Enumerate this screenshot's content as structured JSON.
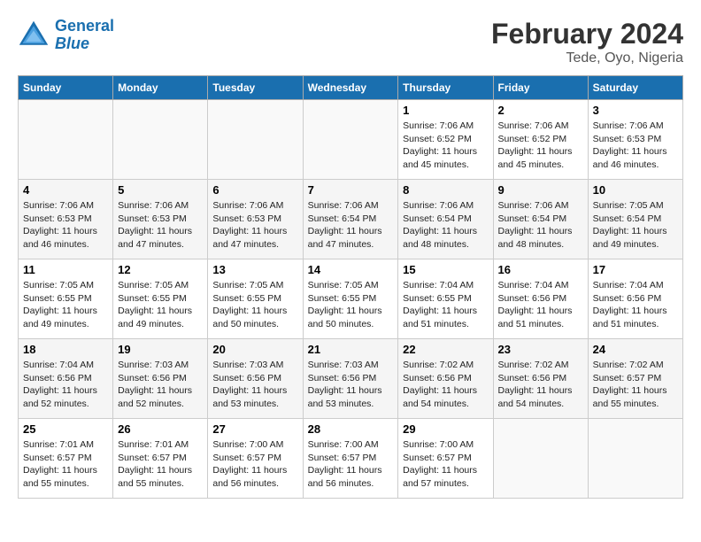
{
  "header": {
    "logo_line1": "General",
    "logo_line2": "Blue",
    "month_title": "February 2024",
    "subtitle": "Tede, Oyo, Nigeria"
  },
  "columns": [
    "Sunday",
    "Monday",
    "Tuesday",
    "Wednesday",
    "Thursday",
    "Friday",
    "Saturday"
  ],
  "rows": [
    [
      {
        "day": "",
        "info": ""
      },
      {
        "day": "",
        "info": ""
      },
      {
        "day": "",
        "info": ""
      },
      {
        "day": "",
        "info": ""
      },
      {
        "day": "1",
        "info": "Sunrise: 7:06 AM\nSunset: 6:52 PM\nDaylight: 11 hours\nand 45 minutes."
      },
      {
        "day": "2",
        "info": "Sunrise: 7:06 AM\nSunset: 6:52 PM\nDaylight: 11 hours\nand 45 minutes."
      },
      {
        "day": "3",
        "info": "Sunrise: 7:06 AM\nSunset: 6:53 PM\nDaylight: 11 hours\nand 46 minutes."
      }
    ],
    [
      {
        "day": "4",
        "info": "Sunrise: 7:06 AM\nSunset: 6:53 PM\nDaylight: 11 hours\nand 46 minutes."
      },
      {
        "day": "5",
        "info": "Sunrise: 7:06 AM\nSunset: 6:53 PM\nDaylight: 11 hours\nand 47 minutes."
      },
      {
        "day": "6",
        "info": "Sunrise: 7:06 AM\nSunset: 6:53 PM\nDaylight: 11 hours\nand 47 minutes."
      },
      {
        "day": "7",
        "info": "Sunrise: 7:06 AM\nSunset: 6:54 PM\nDaylight: 11 hours\nand 47 minutes."
      },
      {
        "day": "8",
        "info": "Sunrise: 7:06 AM\nSunset: 6:54 PM\nDaylight: 11 hours\nand 48 minutes."
      },
      {
        "day": "9",
        "info": "Sunrise: 7:06 AM\nSunset: 6:54 PM\nDaylight: 11 hours\nand 48 minutes."
      },
      {
        "day": "10",
        "info": "Sunrise: 7:05 AM\nSunset: 6:54 PM\nDaylight: 11 hours\nand 49 minutes."
      }
    ],
    [
      {
        "day": "11",
        "info": "Sunrise: 7:05 AM\nSunset: 6:55 PM\nDaylight: 11 hours\nand 49 minutes."
      },
      {
        "day": "12",
        "info": "Sunrise: 7:05 AM\nSunset: 6:55 PM\nDaylight: 11 hours\nand 49 minutes."
      },
      {
        "day": "13",
        "info": "Sunrise: 7:05 AM\nSunset: 6:55 PM\nDaylight: 11 hours\nand 50 minutes."
      },
      {
        "day": "14",
        "info": "Sunrise: 7:05 AM\nSunset: 6:55 PM\nDaylight: 11 hours\nand 50 minutes."
      },
      {
        "day": "15",
        "info": "Sunrise: 7:04 AM\nSunset: 6:55 PM\nDaylight: 11 hours\nand 51 minutes."
      },
      {
        "day": "16",
        "info": "Sunrise: 7:04 AM\nSunset: 6:56 PM\nDaylight: 11 hours\nand 51 minutes."
      },
      {
        "day": "17",
        "info": "Sunrise: 7:04 AM\nSunset: 6:56 PM\nDaylight: 11 hours\nand 51 minutes."
      }
    ],
    [
      {
        "day": "18",
        "info": "Sunrise: 7:04 AM\nSunset: 6:56 PM\nDaylight: 11 hours\nand 52 minutes."
      },
      {
        "day": "19",
        "info": "Sunrise: 7:03 AM\nSunset: 6:56 PM\nDaylight: 11 hours\nand 52 minutes."
      },
      {
        "day": "20",
        "info": "Sunrise: 7:03 AM\nSunset: 6:56 PM\nDaylight: 11 hours\nand 53 minutes."
      },
      {
        "day": "21",
        "info": "Sunrise: 7:03 AM\nSunset: 6:56 PM\nDaylight: 11 hours\nand 53 minutes."
      },
      {
        "day": "22",
        "info": "Sunrise: 7:02 AM\nSunset: 6:56 PM\nDaylight: 11 hours\nand 54 minutes."
      },
      {
        "day": "23",
        "info": "Sunrise: 7:02 AM\nSunset: 6:56 PM\nDaylight: 11 hours\nand 54 minutes."
      },
      {
        "day": "24",
        "info": "Sunrise: 7:02 AM\nSunset: 6:57 PM\nDaylight: 11 hours\nand 55 minutes."
      }
    ],
    [
      {
        "day": "25",
        "info": "Sunrise: 7:01 AM\nSunset: 6:57 PM\nDaylight: 11 hours\nand 55 minutes."
      },
      {
        "day": "26",
        "info": "Sunrise: 7:01 AM\nSunset: 6:57 PM\nDaylight: 11 hours\nand 55 minutes."
      },
      {
        "day": "27",
        "info": "Sunrise: 7:00 AM\nSunset: 6:57 PM\nDaylight: 11 hours\nand 56 minutes."
      },
      {
        "day": "28",
        "info": "Sunrise: 7:00 AM\nSunset: 6:57 PM\nDaylight: 11 hours\nand 56 minutes."
      },
      {
        "day": "29",
        "info": "Sunrise: 7:00 AM\nSunset: 6:57 PM\nDaylight: 11 hours\nand 57 minutes."
      },
      {
        "day": "",
        "info": ""
      },
      {
        "day": "",
        "info": ""
      }
    ]
  ]
}
